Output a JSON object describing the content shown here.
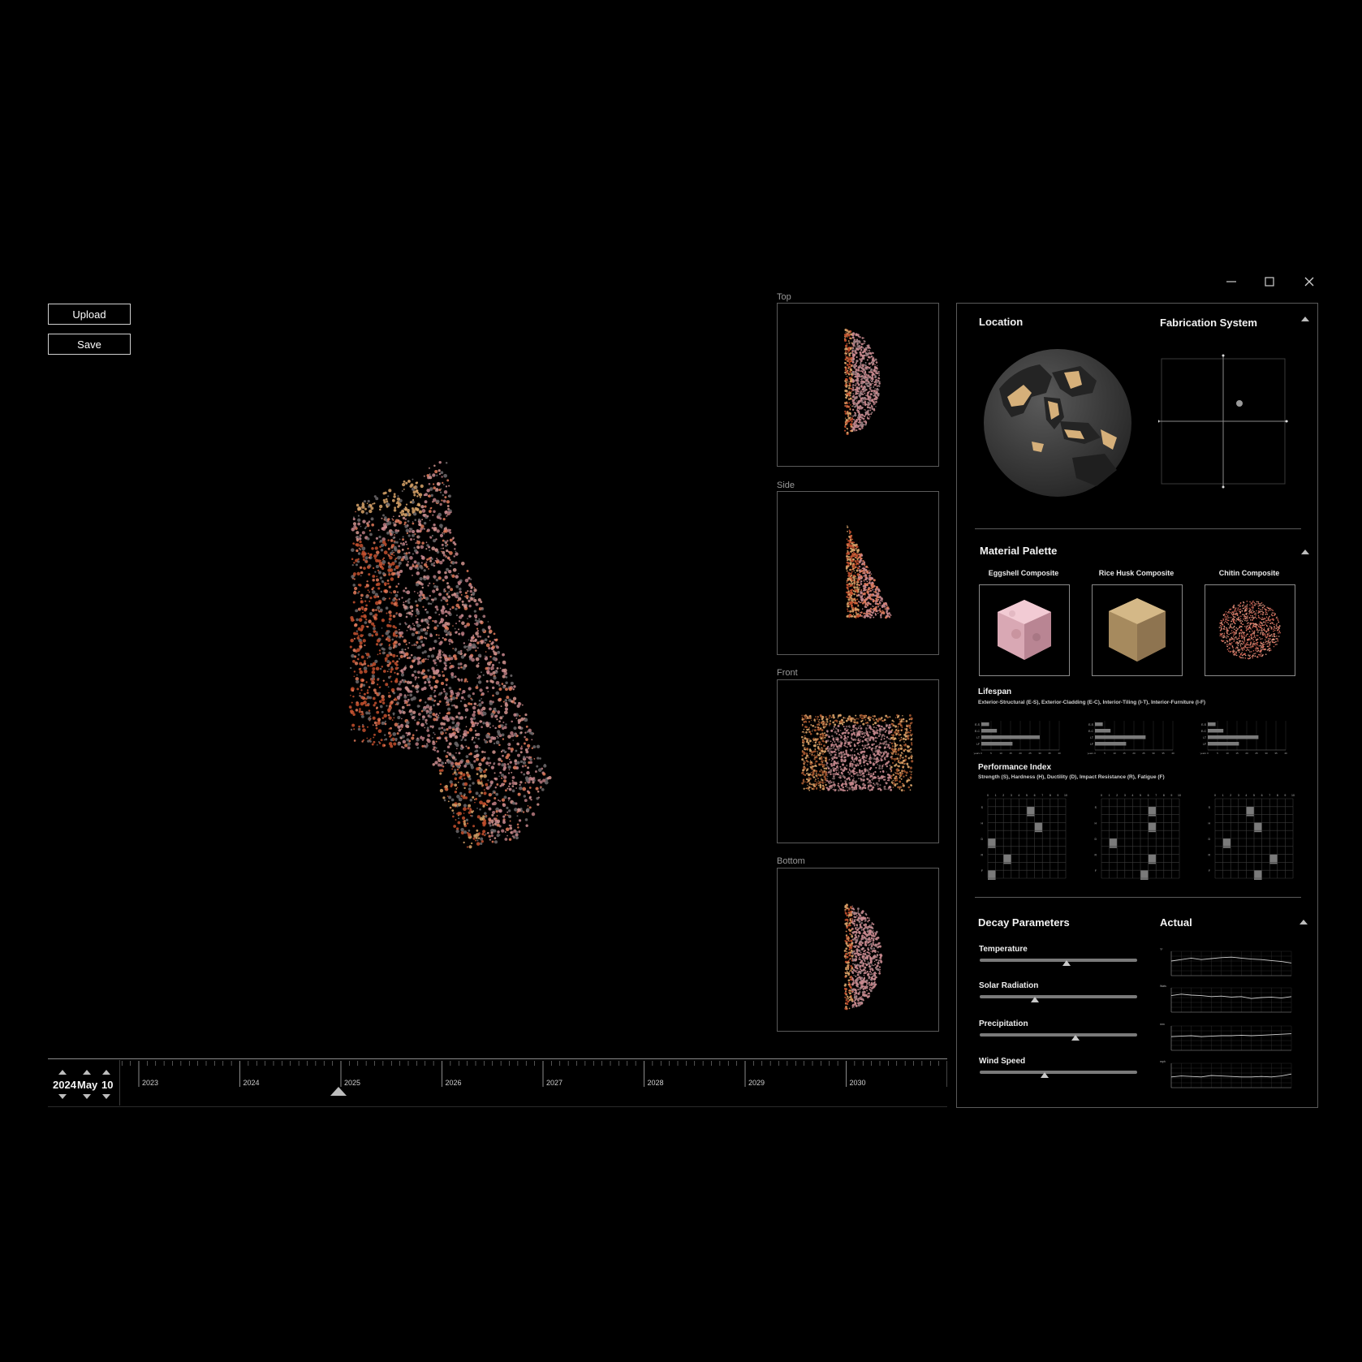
{
  "toolbar": {
    "upload_label": "Upload",
    "save_label": "Save"
  },
  "window_controls": {
    "minimize": "minimize-icon",
    "maximize": "maximize-icon",
    "close": "close-icon"
  },
  "views": [
    {
      "label": "Top"
    },
    {
      "label": "Side"
    },
    {
      "label": "Front"
    },
    {
      "label": "Bottom"
    }
  ],
  "location": {
    "title": "Location"
  },
  "fabrication": {
    "title": "Fabrication System"
  },
  "material_palette": {
    "title": "Material Palette",
    "materials": [
      {
        "name": "Eggshell Composite",
        "color": "#e8b7c3"
      },
      {
        "name": "Rice Husk Composite",
        "color": "#b89a6a"
      },
      {
        "name": "Chitin Composite",
        "color": "#d96a5a"
      }
    ]
  },
  "lifespan": {
    "title": "Lifespan",
    "subtitle": "Exterior-Structural (E-S), Exterior-Cladding (E-C), Interior-Tiling (I-T), Interior-Furniture (I-F)",
    "row_labels": [
      "E-S",
      "E-C",
      "I-T",
      "I-F"
    ],
    "x_title": "years",
    "x_ticks": [
      "0",
      "5",
      "10",
      "15",
      "20",
      "25",
      "30",
      "35",
      "40"
    ],
    "charts": [
      {
        "values": [
          4,
          8,
          30,
          16
        ]
      },
      {
        "values": [
          4,
          8,
          26,
          16
        ]
      },
      {
        "values": [
          4,
          8,
          26,
          16
        ]
      }
    ]
  },
  "performance": {
    "title": "Performance Index",
    "subtitle": "Strength (S), Hardness (H), Ductility (D), Impact Resistance (R), Fatigue (F)",
    "col_ticks": [
      "0",
      "1",
      "2",
      "3",
      "4",
      "5",
      "6",
      "7",
      "8",
      "9",
      "10"
    ],
    "row_labels": [
      "S",
      "H",
      "D",
      "R",
      "F"
    ],
    "charts": [
      {
        "cells": [
          [
            5,
            0
          ],
          [
            6,
            1
          ],
          [
            0,
            2
          ],
          [
            2,
            3
          ],
          [
            0,
            4
          ]
        ]
      },
      {
        "cells": [
          [
            6,
            0
          ],
          [
            6,
            1
          ],
          [
            1,
            2
          ],
          [
            6,
            3
          ],
          [
            5,
            4
          ]
        ]
      },
      {
        "cells": [
          [
            4,
            0
          ],
          [
            5,
            1
          ],
          [
            1,
            2
          ],
          [
            7,
            3
          ],
          [
            5,
            4
          ]
        ]
      }
    ]
  },
  "decay": {
    "title": "Decay Parameters",
    "actual_title": "Actual",
    "params": [
      {
        "label": "Temperature",
        "value": 0.55,
        "unit": "°F",
        "series": [
          3,
          3.3,
          3.6,
          3.3,
          3.5,
          3.7,
          3.8,
          3.6,
          3.4,
          3.3,
          3.1,
          2.9,
          2.6
        ]
      },
      {
        "label": "Solar Radiation",
        "value": 0.35,
        "unit": "Wats",
        "series": [
          3.4,
          3.7,
          3.5,
          3.4,
          3.2,
          3.3,
          3.1,
          3.2,
          2.8,
          3,
          3.1,
          2.9,
          3.2
        ]
      },
      {
        "label": "Precipitation",
        "value": 0.61,
        "unit": "mm",
        "series": [
          2.8,
          2.9,
          3,
          2.8,
          2.9,
          3,
          3,
          3.1,
          3,
          3.1,
          3.2,
          3.3,
          3.4
        ]
      },
      {
        "label": "Wind Speed",
        "value": 0.41,
        "unit": "mph",
        "series": [
          2.2,
          2.4,
          2.3,
          2.2,
          2.5,
          2.4,
          2.3,
          2.2,
          2.2,
          2.3,
          2.2,
          2.4,
          2.8
        ]
      }
    ]
  },
  "timeline": {
    "year": "2024",
    "month": "May",
    "day": "10",
    "years": [
      "2023",
      "2024",
      "2025",
      "2026",
      "2027",
      "2028",
      "2029",
      "2030"
    ],
    "cursor_position": 0.265
  }
}
